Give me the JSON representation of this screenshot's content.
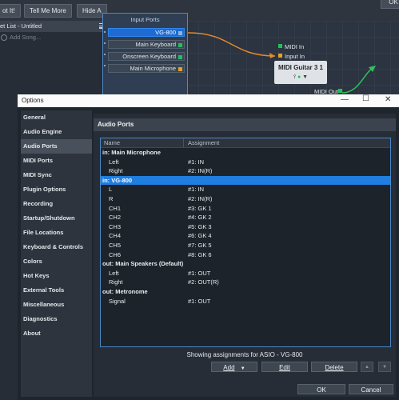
{
  "top_bar": {
    "buttons": [
      "ot It!",
      "Tell Me More",
      "Hide A"
    ],
    "ok_label": "OK"
  },
  "setlist": {
    "title": "et List - Untitled",
    "add_song": "Add Song..."
  },
  "input_ports": {
    "title": "Input Ports",
    "ports": [
      {
        "label": "VG-800",
        "color": "#8fb3dd",
        "selected": true
      },
      {
        "label": "Main Keyboard",
        "color": "#21c15a",
        "selected": false
      },
      {
        "label": "Onscreen Keyboard",
        "color": "#21c15a",
        "selected": false
      },
      {
        "label": "Main Microphone",
        "color": "#e0a326",
        "selected": false
      }
    ]
  },
  "midi_node": {
    "midi_in": "MIDI In",
    "input_in": "Input In",
    "plugin_name": "MIDI Guitar 3 1",
    "midi_out": "MIDI Out"
  },
  "dialog": {
    "title": "Options",
    "sidebar": [
      "General",
      "Audio Engine",
      "Audio Ports",
      "MIDI Ports",
      "MIDI Sync",
      "Plugin Options",
      "Recording",
      "Startup/Shutdown",
      "File Locations",
      "Keyboard & Controls",
      "Colors",
      "Hot Keys",
      "External Tools",
      "Miscellaneous",
      "Diagnostics",
      "About"
    ],
    "active_index": 2,
    "section_title": "Audio Ports",
    "table": {
      "col_name": "Name",
      "col_assignment": "Assignment",
      "rows": [
        {
          "name": "in: Main Microphone",
          "assign": "",
          "group": true
        },
        {
          "name": "Left",
          "assign": "#1: IN"
        },
        {
          "name": "Right",
          "assign": "#2: IN(R)"
        },
        {
          "name": "in: VG-800",
          "assign": "",
          "group": true,
          "selected": true
        },
        {
          "name": "L",
          "assign": "#1: IN"
        },
        {
          "name": "R",
          "assign": "#2: IN(R)"
        },
        {
          "name": "CH1",
          "assign": "#3: GK 1"
        },
        {
          "name": "CH2",
          "assign": "#4: GK 2"
        },
        {
          "name": "CH3",
          "assign": "#5: GK 3"
        },
        {
          "name": "CH4",
          "assign": "#6: GK 4"
        },
        {
          "name": "CH5",
          "assign": "#7: GK 5"
        },
        {
          "name": "CH6",
          "assign": "#8: GK 6"
        },
        {
          "name": "out: Main Speakers (Default)",
          "assign": "",
          "group": true
        },
        {
          "name": "Left",
          "assign": "#1: OUT"
        },
        {
          "name": "Right",
          "assign": "#2: OUT(R)"
        },
        {
          "name": "out: Metronome",
          "assign": "",
          "group": true
        },
        {
          "name": "Signal",
          "assign": "#1: OUT"
        }
      ]
    },
    "status": "Showing assignments for ASIO - VG-800",
    "buttons": {
      "add": "Add",
      "edit": "Edit",
      "delete": "Delete",
      "ok": "OK",
      "cancel": "Cancel"
    }
  }
}
